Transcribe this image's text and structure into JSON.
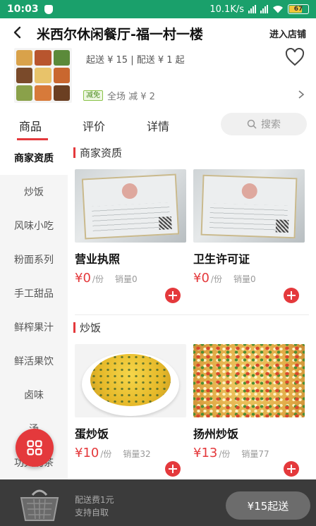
{
  "status_bar": {
    "time": "10:03",
    "network_speed": "10.1K/s",
    "battery": "67"
  },
  "header": {
    "title": "米西尔休闲餐厅-福一村一楼",
    "enter_store": "进入店铺"
  },
  "store": {
    "delivery_info": "起送 ¥ 15 | 配送 ¥ 1 起",
    "promo_badge": "减免",
    "promo_text": "全场 减 ¥ 2"
  },
  "tabs": [
    {
      "label": "商品"
    },
    {
      "label": "评价"
    },
    {
      "label": "详情"
    }
  ],
  "search": {
    "placeholder": "搜索"
  },
  "sidebar": {
    "items": [
      {
        "label": "商家资质"
      },
      {
        "label": "炒饭"
      },
      {
        "label": "风味小吃"
      },
      {
        "label": "粉面系列"
      },
      {
        "label": "手工甜品"
      },
      {
        "label": "鲜榨果汁"
      },
      {
        "label": "鲜活果饮"
      },
      {
        "label": "卤味"
      },
      {
        "label": "汤"
      },
      {
        "label": "功夫奶茶"
      }
    ]
  },
  "sections": [
    {
      "title": "商家资质",
      "items": [
        {
          "name": "营业执照",
          "price": "¥0",
          "unit": "/份",
          "sales": "销量0"
        },
        {
          "name": "卫生许可证",
          "price": "¥0",
          "unit": "/份",
          "sales": "销量0"
        }
      ]
    },
    {
      "title": "炒饭",
      "items": [
        {
          "name": "蛋炒饭",
          "price": "¥10",
          "unit": "/份",
          "sales": "销量32"
        },
        {
          "name": "扬州炒饭",
          "price": "¥13",
          "unit": "/份",
          "sales": "销量77"
        }
      ]
    }
  ],
  "bottom_bar": {
    "delivery_fee": "配送费1元",
    "pickup": "支持自取",
    "min_order": "¥15起送"
  },
  "colors": {
    "status_bar": "#1aa06b",
    "accent": "#e4393c",
    "bottom_bar": "#3b3b3b"
  },
  "icons": [
    "back-icon",
    "heart-icon",
    "chevron-right-icon",
    "search-icon",
    "grid-menu-icon",
    "cart-basket-icon",
    "plus-icon"
  ]
}
